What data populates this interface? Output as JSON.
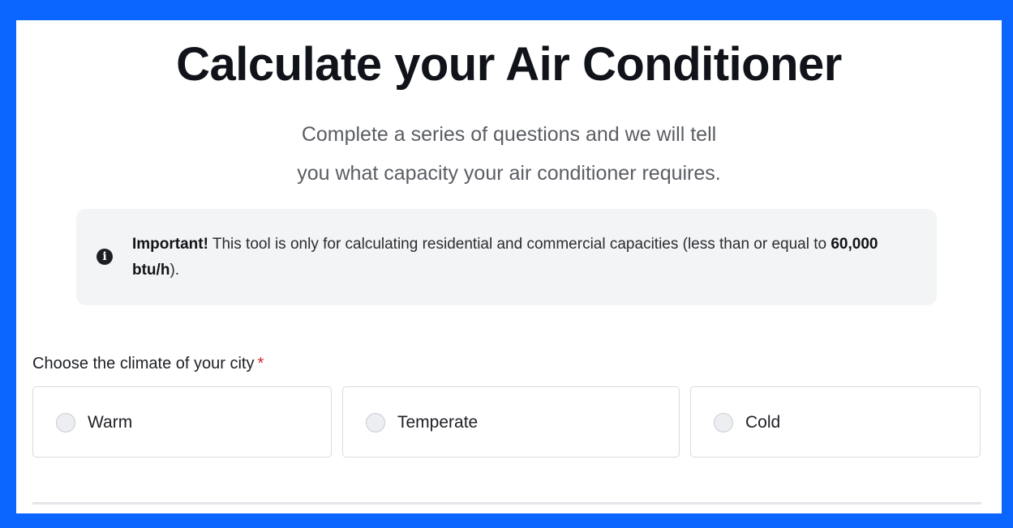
{
  "header": {
    "title": "Calculate your Air Conditioner",
    "subtitle_line1": "Complete a series of questions and we will tell",
    "subtitle_line2": "you what capacity your air conditioner requires."
  },
  "notice": {
    "icon": "info-icon",
    "strong_lead": "Important!",
    "text_part1": " This tool is only for calculating residential and commercial capacities (less than or equal to ",
    "strong_value": "60,000 btu/h",
    "text_part2": ")."
  },
  "climate_question": {
    "label": "Choose the climate of your city",
    "required_marker": "*",
    "options": [
      {
        "label": "Warm",
        "selected": false
      },
      {
        "label": "Temperate",
        "selected": false
      },
      {
        "label": "Cold",
        "selected": false
      }
    ]
  },
  "colors": {
    "frame": "#0a66ff",
    "panel": "#ffffff",
    "notice_bg": "#f3f4f6",
    "required": "#d62828",
    "title": "#11131a"
  }
}
